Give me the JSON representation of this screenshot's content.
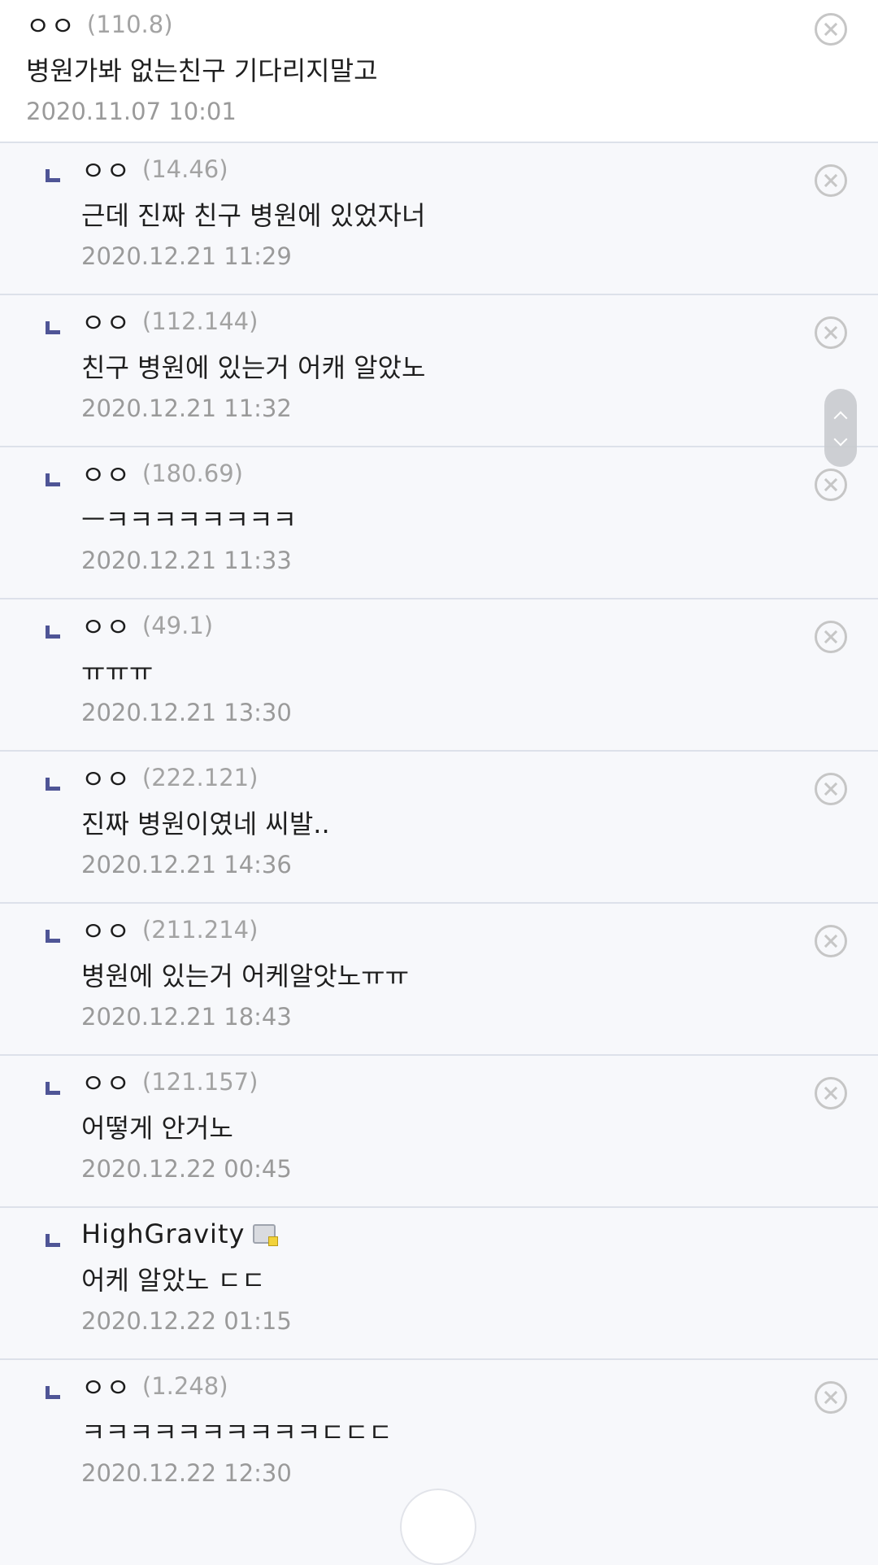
{
  "comments": [
    {
      "nick": "ㅇㅇ",
      "ip": "(110.8)",
      "text": "병원가봐 없는친구 기다리지말고",
      "time": "2020.11.07 10:01"
    },
    {
      "nick": "ㅇㅇ",
      "ip": "(14.46)",
      "text": "근데 진짜 친구 병원에 있었자너",
      "time": "2020.12.21 11:29"
    },
    {
      "nick": "ㅇㅇ",
      "ip": "(112.144)",
      "text": "친구 병원에 있는거 어캐 알았노",
      "time": "2020.12.21 11:32"
    },
    {
      "nick": "ㅇㅇ",
      "ip": "(180.69)",
      "text": "ㅡㅋㅋㅋㅋㅋㅋㅋㅋ",
      "time": "2020.12.21 11:33"
    },
    {
      "nick": "ㅇㅇ",
      "ip": "(49.1)",
      "text": "ㅠㅠㅠ",
      "time": "2020.12.21 13:30"
    },
    {
      "nick": "ㅇㅇ",
      "ip": "(222.121)",
      "text": "진짜 병원이였네 씨발..",
      "time": "2020.12.21 14:36"
    },
    {
      "nick": "ㅇㅇ",
      "ip": "(211.214)",
      "text": "병원에 있는거 어케알앗노ㅠㅠ",
      "time": "2020.12.21 18:43"
    },
    {
      "nick": "ㅇㅇ",
      "ip": "(121.157)",
      "text": "어떻게 안거노",
      "time": "2020.12.22 00:45"
    },
    {
      "nick": "HighGravity",
      "ip": "",
      "text": "어케 알았노 ㄷㄷ",
      "time": "2020.12.22 01:15"
    },
    {
      "nick": "ㅇㅇ",
      "ip": "(1.248)",
      "text": "ㅋㅋㅋㅋㅋㅋㅋㅋㅋㅋㄷㄷㄷ",
      "time": "2020.12.22 12:30"
    }
  ],
  "icons": {
    "reply": "reply-arrow-icon",
    "delete": "close-circle-icon",
    "gallog": "gallog-member-icon",
    "scroll_up": "chevron-up-icon",
    "scroll_down": "chevron-down-icon"
  }
}
